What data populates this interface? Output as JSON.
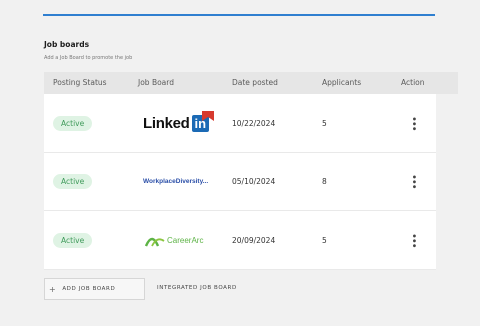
{
  "section": {
    "title": "Job boards",
    "subtitle": "Add a Job Board to promote the job"
  },
  "table": {
    "headers": [
      "Posting Status",
      "Job Board",
      "Date posted",
      "Applicants",
      "Action"
    ],
    "rows": [
      {
        "status": "Active",
        "board": "LinkedIn",
        "board_logo_text": "Linked",
        "board_logo_text2": "in",
        "date": "10/22/2024",
        "applicants": "5"
      },
      {
        "status": "Active",
        "board": "WorkplaceDiversity...",
        "board_logo_text": "WorkplaceDiversity...",
        "date": "05/10/2024",
        "applicants": "8"
      },
      {
        "status": "Active",
        "board": "CareerArc",
        "board_logo_text": "CareerArc",
        "date": "20/09/2024",
        "applicants": "5"
      }
    ]
  },
  "actions": {
    "add_job_board": "ADD JOB BOARD",
    "integrated_job_board": "INTEGRATED JOB BOARD"
  },
  "colors": {
    "accent": "#2f7fd0",
    "active_bg": "#dff3e4",
    "active_text": "#3f9a5a",
    "linkedin_blue": "#1b6ab5",
    "careerarc_green": "#5db346"
  }
}
